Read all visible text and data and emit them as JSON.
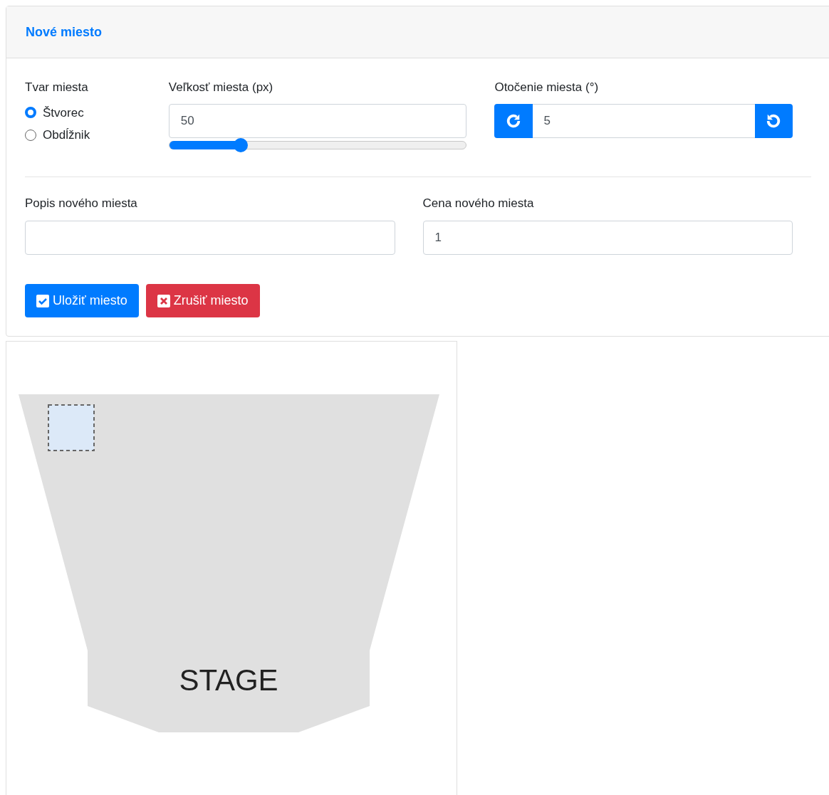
{
  "card": {
    "title": "Nové miesto"
  },
  "shape": {
    "label": "Tvar miesta",
    "options": [
      {
        "label": "Štvorec",
        "selected": true
      },
      {
        "label": "Obdĺžnik",
        "selected": false
      }
    ]
  },
  "size": {
    "label": "Veľkosť miesta (px)",
    "value": "50",
    "level": 0.24
  },
  "rotation": {
    "label": "Otočenie miesta (°)",
    "value": "5"
  },
  "description": {
    "label": "Popis nového miesta"
  },
  "price": {
    "label": "Cena nového miesta",
    "value": "1"
  },
  "buttons": [
    {
      "label": "Uložiť miesto",
      "kind": "save"
    },
    {
      "label": "Zrušiť miesto",
      "kind": "cancel"
    }
  ],
  "canvas": {
    "stage_label": "STAGE"
  }
}
